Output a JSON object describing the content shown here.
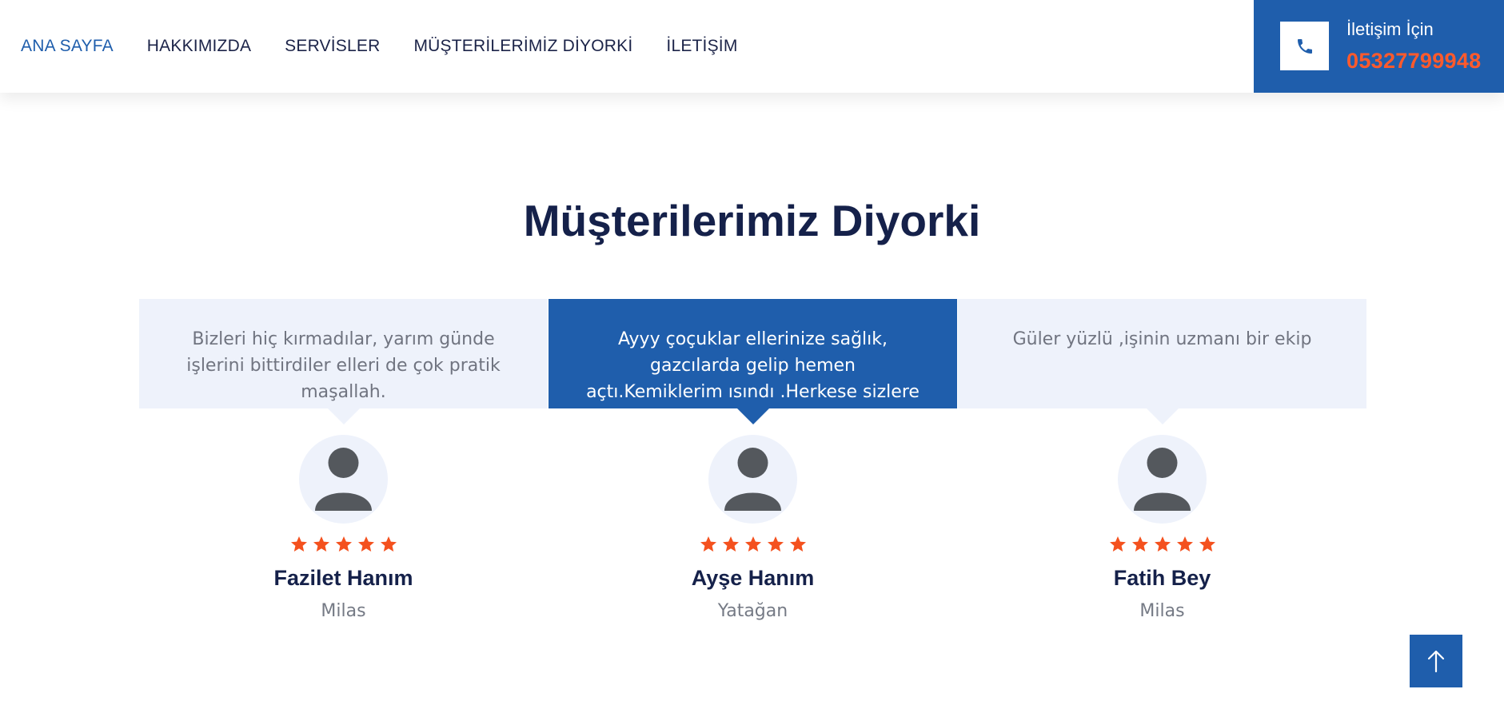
{
  "nav": {
    "items": [
      {
        "label": "ANA SAYFA",
        "active": true
      },
      {
        "label": "HAKKIMIZDA",
        "active": false
      },
      {
        "label": "SERVİSLER",
        "active": false
      },
      {
        "label": "MÜŞTERİLERİMİZ DİYORKİ",
        "active": false
      },
      {
        "label": "İLETİŞİM",
        "active": false
      }
    ]
  },
  "contact": {
    "label": "İletişim İçin",
    "phone": "05327799948",
    "icon": "phone-icon"
  },
  "section": {
    "title": "Müşterilerimiz Diyorki"
  },
  "testimonials": [
    {
      "quote": "Bizleri hiç kırmadılar, yarım günde işlerini bittirdiler elleri de çok pratik maşallah.",
      "rating": 5,
      "name": "Fazilet Hanım",
      "city": "Milas",
      "highlighted": false
    },
    {
      "quote": "Ayyy çoçuklar ellerinize sağlık, gazcılarda gelip hemen açtı.Kemiklerim ısındı .Herkese sizlere yönlendiriyorum",
      "rating": 5,
      "name": "Ayşe Hanım",
      "city": "Yatağan",
      "highlighted": true
    },
    {
      "quote": "Güler yüzlü ,işinin uzmanı bir ekip",
      "rating": 5,
      "name": "Fatih Bey",
      "city": "Milas",
      "highlighted": false
    }
  ],
  "colors": {
    "primary": "#1f5eac",
    "accent": "#ff5a2c",
    "dark": "#15214a",
    "light_bg": "#eef2fb"
  },
  "icons": {
    "avatar": "user-avatar-icon",
    "star": "star-icon",
    "scroll_top": "arrow-up-icon"
  }
}
